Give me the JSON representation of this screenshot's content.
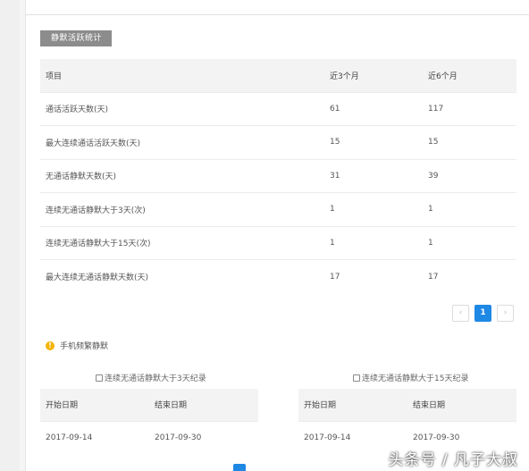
{
  "section_tag": "静默活跃统计",
  "stats_table": {
    "headers": [
      "项目",
      "近3个月",
      "近6个月"
    ],
    "rows": [
      {
        "item": "通话活跃天数(天)",
        "m3": "61",
        "m6": "117"
      },
      {
        "item": "最大连续通话活跃天数(天)",
        "m3": "15",
        "m6": "15"
      },
      {
        "item": "无通话静默天数(天)",
        "m3": "31",
        "m6": "39"
      },
      {
        "item": "连续无通话静默大于3天(次)",
        "m3": "1",
        "m6": "1"
      },
      {
        "item": "连续无通话静默大于15天(次)",
        "m3": "1",
        "m6": "1"
      },
      {
        "item": "最大连续无通话静默天数(天)",
        "m3": "17",
        "m6": "17"
      }
    ]
  },
  "pagination": {
    "prev": "‹",
    "current": "1",
    "next": "›"
  },
  "notice": {
    "icon": "!",
    "text": "手机频繁静默"
  },
  "left_record": {
    "title": "连续无通话静默大于3天纪录",
    "headers": [
      "开始日期",
      "结束日期"
    ],
    "rows": [
      {
        "start": "2017-09-14",
        "end": "2017-09-30"
      }
    ]
  },
  "right_record": {
    "title": "连续无通话静默大于15天纪录",
    "headers": [
      "开始日期",
      "结束日期"
    ],
    "rows": [
      {
        "start": "2017-09-14",
        "end": "2017-09-30"
      }
    ]
  },
  "watermark": "头条号 / 凡子大叔",
  "colors": {
    "accent": "#1e88e5",
    "tag_bg": "#8c8c8c",
    "warn": "#f5b400"
  }
}
